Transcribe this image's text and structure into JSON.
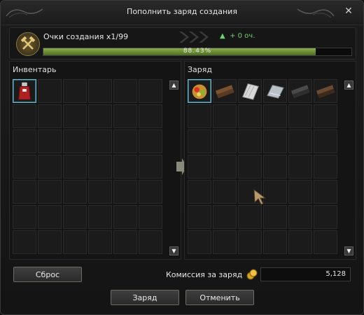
{
  "window": {
    "title": "Пополнить заряд создания",
    "close_glyph": "✕"
  },
  "points": {
    "label": "Очки создания x1/99",
    "gain_arrow": "▲",
    "gain_text": "+ 0 оч.",
    "progress_text": "88.43%",
    "progress_fraction": 0.8843,
    "icon": "crossed-hammers-icon"
  },
  "inventory": {
    "title": "Инвентарь",
    "item_icons": [
      "red-potion-icon"
    ]
  },
  "charge": {
    "title": "Заряд",
    "item_icons": [
      "fruit-basket-icon",
      "wooden-plank-icon",
      "cloth-bundle-icon",
      "steel-ingot-icon",
      "dark-plank-icon",
      "brown-plank-icon"
    ]
  },
  "buttons": {
    "reset": "Сброс",
    "charge": "Заряд",
    "cancel": "Отменить"
  },
  "fee": {
    "label": "Комиссия за заряд",
    "value": "5,128",
    "icon": "gold-coins-icon"
  },
  "colors": {
    "progress": "#7a9a3c",
    "gain": "#6fd06f",
    "selection": "#6fb7c7"
  }
}
